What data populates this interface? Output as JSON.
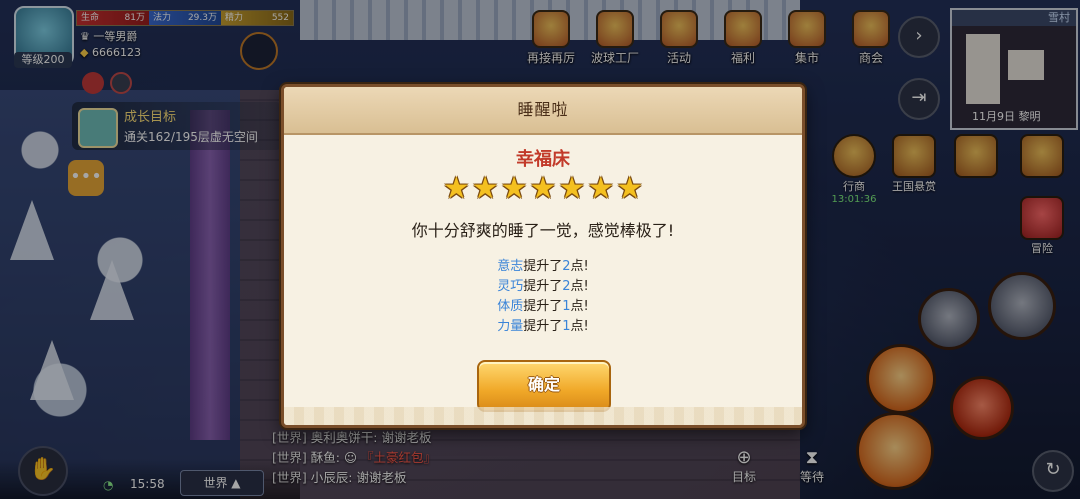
{
  "hud": {
    "level": "等级200",
    "hp_label": "生命",
    "hp_value": "81万",
    "mp_label": "法力",
    "mp_value": "29.3万",
    "sp_label": "精力",
    "sp_value": "552",
    "title": "一等男爵",
    "gold": "6666123"
  },
  "growth": {
    "title": "成长目标",
    "desc": "通关162/195层虚无空间"
  },
  "top_menu": [
    {
      "label": "再接再厉",
      "icon": "dice-icon"
    },
    {
      "label": "波球工厂",
      "icon": "factory-icon"
    },
    {
      "label": "活动",
      "icon": "event-icon"
    },
    {
      "label": "福利",
      "icon": "gift-icon"
    },
    {
      "label": "集市",
      "icon": "market-icon"
    },
    {
      "label": "商会",
      "icon": "scale-icon"
    }
  ],
  "minimap": {
    "location": "雪村",
    "date": "11月9日",
    "time_of_day": "黎明"
  },
  "right_side": {
    "merchant_label": "行商",
    "merchant_timer": "13:01:36",
    "bounty_label": "王国悬赏",
    "adventure_label": "冒险"
  },
  "dialog": {
    "title": "睡醒啦",
    "bed_name": "幸福床",
    "star_count": 7,
    "message": "你十分舒爽的睡了一觉，感觉棒极了!",
    "stats": [
      {
        "name": "意志",
        "mid": "提升了",
        "num": "2",
        "end": "点!"
      },
      {
        "name": "灵巧",
        "mid": "提升了",
        "num": "2",
        "end": "点!"
      },
      {
        "name": "体质",
        "mid": "提升了",
        "num": "1",
        "end": "点!"
      },
      {
        "name": "力量",
        "mid": "提升了",
        "num": "1",
        "end": "点!"
      }
    ],
    "confirm_label": "确定"
  },
  "bottom": {
    "clock": "15:58",
    "channel": "世界",
    "target_label": "目标",
    "wait_label": "等待",
    "chat": [
      {
        "channel": "[世界]",
        "speaker": "奥利奥饼干:",
        "text": "谢谢老板",
        "highlight": ""
      },
      {
        "channel": "[世界]",
        "speaker": "酥鱼:",
        "text": "",
        "highlight": "『土豪红包』"
      },
      {
        "channel": "[世界]",
        "speaker": "小辰辰:",
        "text": "谢谢老板",
        "highlight": ""
      }
    ]
  }
}
